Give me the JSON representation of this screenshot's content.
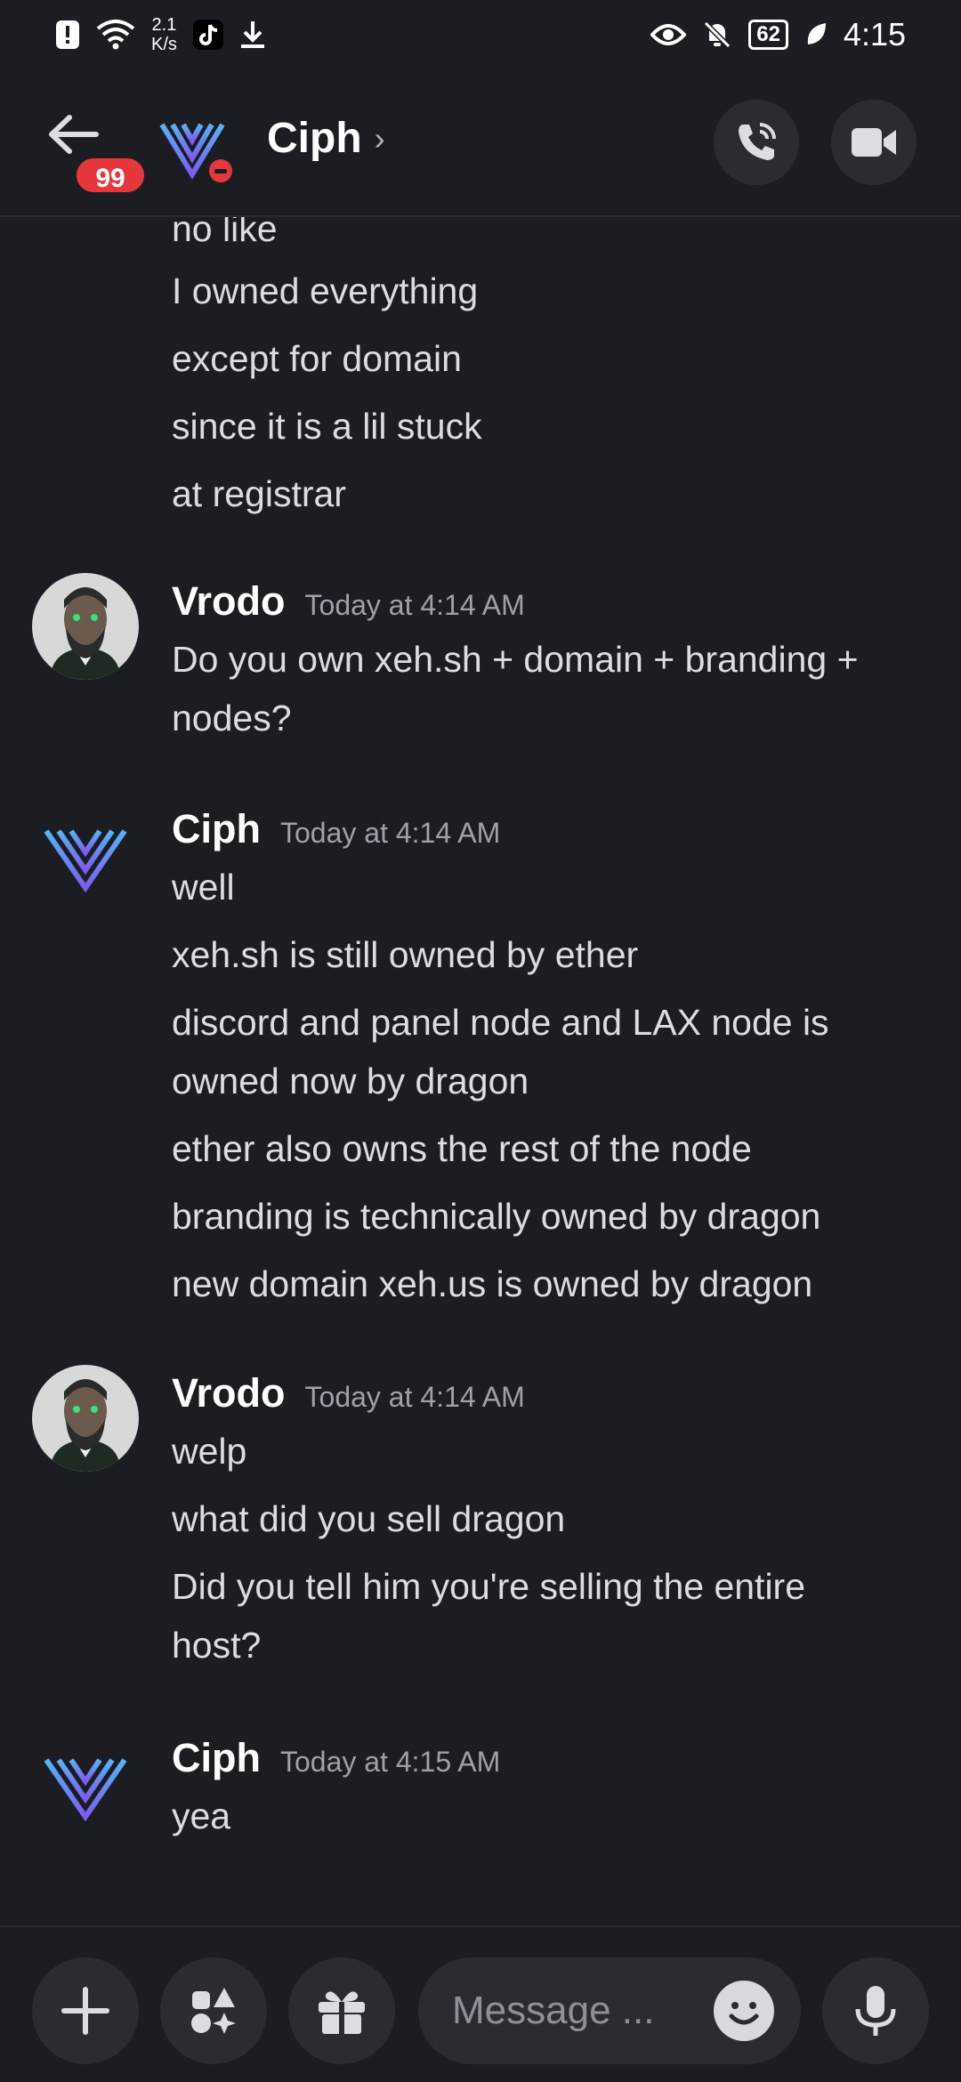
{
  "status_bar": {
    "net_speed_value": "2.1",
    "net_speed_unit": "K/s",
    "battery": "62",
    "time": "4:15"
  },
  "header": {
    "unread_badge": "99",
    "title": "Ciph",
    "chevron": "›"
  },
  "messages": {
    "continued_lines": [
      "no like",
      "I owned everything",
      "except for domain",
      "since it is a lil stuck",
      "at registrar"
    ],
    "groups": [
      {
        "author": "Vrodo",
        "timestamp": "Today at 4:14 AM",
        "lines": [
          "Do you own xeh.sh + domain + branding +",
          "nodes?"
        ]
      },
      {
        "author": "Ciph",
        "timestamp": "Today at 4:14 AM",
        "lines": [
          "well",
          "xeh.sh is still owned by ether",
          "discord and panel node and LAX node is",
          "owned now by dragon",
          "ether also owns the rest of the node",
          "branding is technically owned by dragon",
          "new domain xeh.us is owned by dragon"
        ]
      },
      {
        "author": "Vrodo",
        "timestamp": "Today at 4:14 AM",
        "lines": [
          "welp",
          "what did you sell dragon",
          "Did you tell him you're selling the entire",
          "host?"
        ]
      },
      {
        "author": "Ciph",
        "timestamp": "Today at 4:15 AM",
        "lines": [
          "yea"
        ]
      }
    ]
  },
  "composer": {
    "placeholder": "Message ..."
  },
  "colors": {
    "background": "#1c1d22",
    "surface": "#2b2c32",
    "badge_red": "#e6373c",
    "logo_blue": "#4fa3f7",
    "logo_purple": "#7b5cf0"
  },
  "icons": {
    "status_left": [
      "alert-icon",
      "wifi-icon",
      "tiktok-icon",
      "download-icon"
    ],
    "status_right": [
      "eye-icon",
      "bell-off-icon",
      "battery-icon",
      "leaf-icon"
    ],
    "header": [
      "back-arrow-icon",
      "phone-call-icon",
      "video-camera-icon"
    ],
    "composer": [
      "plus-icon",
      "apps-icon",
      "gift-icon",
      "emoji-icon",
      "microphone-icon"
    ]
  }
}
